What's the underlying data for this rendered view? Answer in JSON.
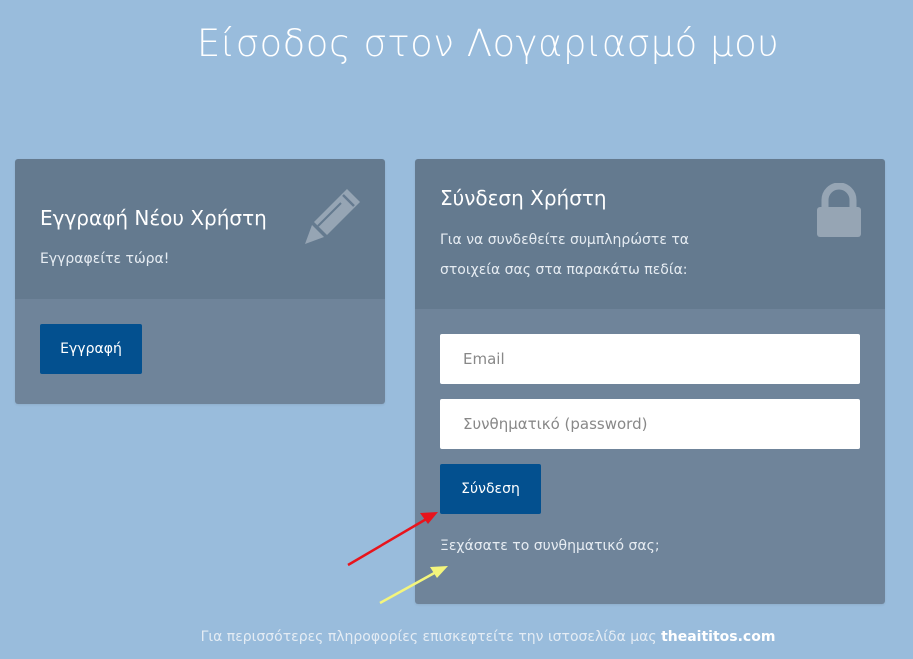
{
  "page": {
    "title": "Είσοδος στον Λογαριασμό μου"
  },
  "register": {
    "title": "Εγγραφή Νέου Χρήστη",
    "subtitle": "Εγγραφείτε τώρα!",
    "icon": "pencil-icon",
    "button_label": "Εγγραφή"
  },
  "login": {
    "title": "Σύνδεση Χρήστη",
    "description": "Για να συνδεθείτε συμπληρώστε τα στοιχεία σας στα παρακάτω πεδία:",
    "icon": "lock-icon",
    "email_placeholder": "Email",
    "password_placeholder": "Συνθηματικό (password)",
    "button_label": "Σύνδεση",
    "forgot_link": "Ξεχάσατε το συνθηματικό σας;"
  },
  "footer": {
    "text": "Για περισσότερες πληροφορίες επισκεφτείτε την ιστοσελίδα μας ",
    "link_text": "theaititos.com"
  },
  "annotations": {
    "red_arrow_color": "#e8141c",
    "yellow_arrow_color": "#f4f57c"
  },
  "colors": {
    "background": "#99bcdc",
    "card_header": "#647a8f",
    "card_body": "#6f849a",
    "button": "#03508f"
  }
}
